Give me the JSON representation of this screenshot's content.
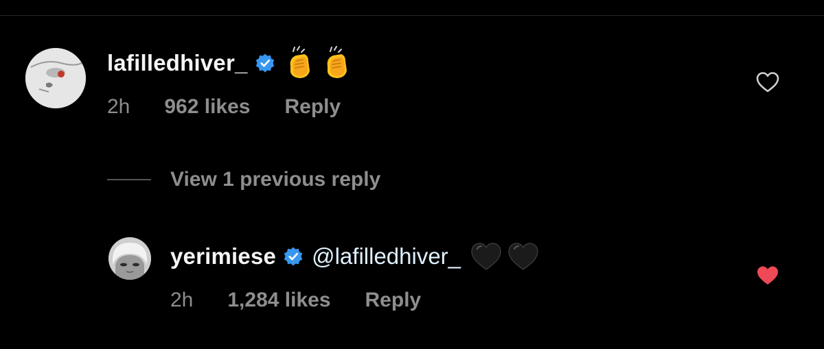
{
  "comments": [
    {
      "username": "lafilledhiver_",
      "verified": true,
      "text": "",
      "mention": "",
      "emojis": [
        "clapping-hands",
        "clapping-hands"
      ],
      "time": "2h",
      "likes": "962 likes",
      "reply_label": "Reply",
      "liked": false
    },
    {
      "username": "yerimiese",
      "verified": true,
      "mention": "@lafilledhiver_",
      "emojis": [
        "black-heart",
        "black-heart"
      ],
      "time": "2h",
      "likes": "1,284 likes",
      "reply_label": "Reply",
      "liked": true
    }
  ],
  "view_replies": {
    "label": "View 1 previous reply"
  },
  "colors": {
    "background": "#000000",
    "text_primary": "#f5f5f5",
    "text_secondary": "#8e8e8e",
    "verified_blue": "#3897f0",
    "liked_red": "#ed4956"
  }
}
